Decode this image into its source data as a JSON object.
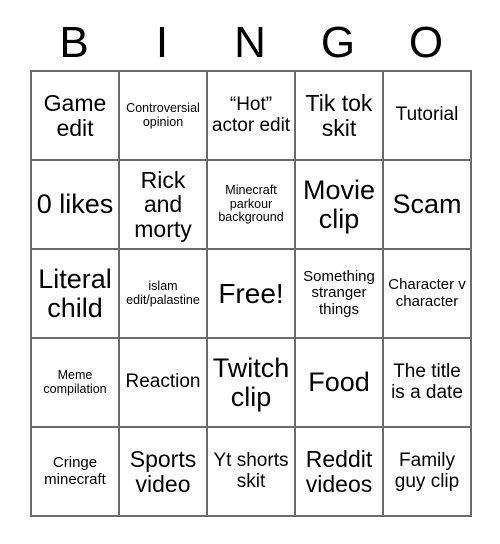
{
  "card": {
    "header_letters": [
      "B",
      "I",
      "N",
      "G",
      "O"
    ],
    "grid_size": "5x5",
    "free_space_label": "Free!",
    "colors": {
      "text": "#000000",
      "grid_line": "#6b6b6b",
      "background": "#ffffff"
    },
    "rows": [
      [
        {
          "text": "Game edit",
          "size": "lg"
        },
        {
          "text": "Controversial opinion",
          "size": "xs"
        },
        {
          "text": "“Hot” actor edit",
          "size": "md"
        },
        {
          "text": "Tik tok skit",
          "size": "lg"
        },
        {
          "text": "Tutorial",
          "size": "md"
        }
      ],
      [
        {
          "text": "0 likes",
          "size": "xl"
        },
        {
          "text": "Rick and morty",
          "size": "lg"
        },
        {
          "text": "Minecraft parkour background",
          "size": "xs"
        },
        {
          "text": "Movie clip",
          "size": "xl"
        },
        {
          "text": "Scam",
          "size": "xl"
        }
      ],
      [
        {
          "text": "Literal child",
          "size": "xl"
        },
        {
          "text": "islam edit/palastine",
          "size": "xs"
        },
        {
          "text": "Free!",
          "size": "free"
        },
        {
          "text": "Something stranger things",
          "size": "sm"
        },
        {
          "text": "Character v character",
          "size": "sm"
        }
      ],
      [
        {
          "text": "Meme compilation",
          "size": "xs"
        },
        {
          "text": "Reaction",
          "size": "md"
        },
        {
          "text": "Twitch clip",
          "size": "xl"
        },
        {
          "text": "Food",
          "size": "xl"
        },
        {
          "text": "The title is a date",
          "size": "md"
        }
      ],
      [
        {
          "text": "Cringe minecraft",
          "size": "sm"
        },
        {
          "text": "Sports video",
          "size": "lg"
        },
        {
          "text": "Yt shorts skit",
          "size": "md"
        },
        {
          "text": "Reddit videos",
          "size": "lg"
        },
        {
          "text": "Family guy clip",
          "size": "md"
        }
      ]
    ]
  }
}
